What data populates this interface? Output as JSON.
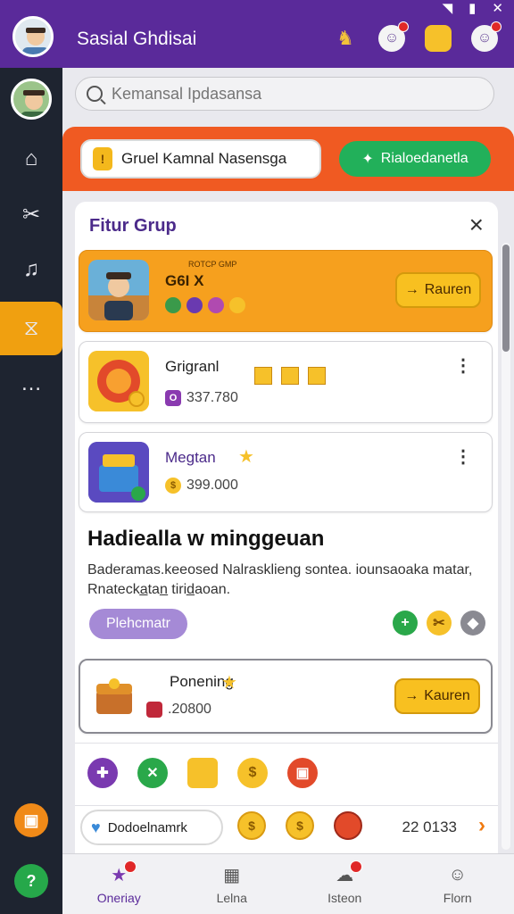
{
  "header": {
    "title": "Sasial Ghdisai",
    "status_icons": [
      "signal-icon",
      "battery-icon",
      "close-icon"
    ],
    "actions": [
      {
        "name": "trophy-icon",
        "glyph": "♞",
        "color": "#f2c23a"
      },
      {
        "name": "alert-icon",
        "glyph": "☺",
        "color": "#f4f4f4",
        "badge": true
      },
      {
        "name": "coins-icon",
        "glyph": "●",
        "color": "#f6c12a"
      },
      {
        "name": "chat-icon",
        "glyph": "☺",
        "color": "#f4f4f4",
        "badge": true
      }
    ]
  },
  "rail": {
    "items": [
      {
        "name": "home-icon",
        "glyph": "⌂"
      },
      {
        "name": "tools-icon",
        "glyph": "✂"
      },
      {
        "name": "music-icon",
        "glyph": "♫"
      },
      {
        "name": "groups-icon",
        "glyph": "⧖"
      },
      {
        "name": "message-icon",
        "glyph": "…"
      }
    ]
  },
  "search": {
    "placeholder": "Kemansal Ipdasansa"
  },
  "band": {
    "pill_text": "Gruel Kamnal Nasensga",
    "button_label": "Rialoedanetla"
  },
  "panel": {
    "title": "Fitur Grup",
    "rows": [
      {
        "name": "G6I X",
        "meta": "ROTCP GMP",
        "button": "Rauren"
      },
      {
        "name": "Grigranl",
        "value": "337.780"
      },
      {
        "name": "Megtan",
        "value": "399.000"
      }
    ],
    "weekly": {
      "title": "Hadiealla w minggeuan",
      "description": "Baderamas.keeosed Nalrasklieng sontea. iounsaoaka matar, Rnatecka̲tan̲ tirid̲aoan.",
      "button": "Plehcmatr"
    },
    "featured": {
      "name": "Ponening",
      "value": ".20800",
      "button": "Kauren"
    },
    "friend_bar": {
      "pill_text": "Dodoelnamrk",
      "count": "22 0133"
    }
  },
  "bottom_nav": [
    {
      "label": "Oneriay",
      "icon": "star-icon",
      "glyph": "★",
      "active": true,
      "badge": true
    },
    {
      "label": "Lelna",
      "icon": "store-icon",
      "glyph": "▦",
      "active": false,
      "badge": false
    },
    {
      "label": "Isteon",
      "icon": "notification-icon",
      "glyph": "☁",
      "active": false,
      "badge": true
    },
    {
      "label": "Florn",
      "icon": "profile-icon",
      "glyph": "☺",
      "active": false,
      "badge": false
    }
  ]
}
